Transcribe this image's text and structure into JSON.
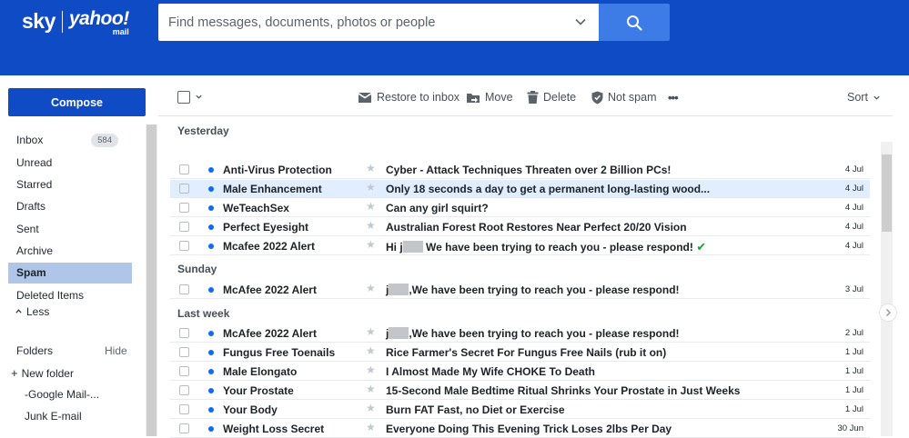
{
  "brand": {
    "sky": "sky",
    "yahoo": "yahoo!",
    "mail": "mail"
  },
  "search": {
    "placeholder": "Find messages, documents, photos or people"
  },
  "sidebar": {
    "compose": "Compose",
    "folders": [
      {
        "label": "Inbox",
        "badge": "584"
      },
      {
        "label": "Unread"
      },
      {
        "label": "Starred"
      },
      {
        "label": "Drafts"
      },
      {
        "label": "Sent"
      },
      {
        "label": "Archive"
      },
      {
        "label": "Spam",
        "active": true
      },
      {
        "label": "Deleted Items"
      }
    ],
    "less": "Less",
    "folders_header": "Folders",
    "hide": "Hide",
    "new_folder": "New folder",
    "custom_folders": [
      "-Google Mail-...",
      "Junk E-mail"
    ]
  },
  "toolbar": {
    "restore": "Restore to inbox",
    "move": "Move",
    "delete": "Delete",
    "not_spam": "Not spam",
    "more": "•••",
    "sort": "Sort"
  },
  "groups": [
    {
      "label": "Yesterday",
      "messages": [
        {
          "from": "Anti-Virus Protection",
          "subject": "Cyber - Attack Techniques Threaten over 2 Billion PCs!",
          "date": "4 Jul"
        },
        {
          "from": "Male Enhancement",
          "subject": "Only 18 seconds a day to get a permanent long-lasting wood...",
          "date": "4 Jul",
          "selected": true
        },
        {
          "from": "WeTeachSex",
          "subject": "Can any girl squirt?",
          "date": "4 Jul"
        },
        {
          "from": "Perfect Eyesight",
          "subject": "Australian Forest Root Restores Near Perfect 20/20 Vision",
          "date": "4 Jul"
        },
        {
          "from": "Mcafee 2022 Alert",
          "subject_pre": "Hi j",
          "subject": " We have been trying to reach you - please respond!",
          "check": "✔",
          "date": "4 Jul"
        }
      ]
    },
    {
      "label": "Sunday",
      "messages": [
        {
          "from": "McAfee 2022 Alert",
          "subject_pre": "j",
          "subject": ",We have been trying to reach you - please respond!",
          "date": "3 Jul"
        }
      ]
    },
    {
      "label": "Last week",
      "messages": [
        {
          "from": "McAfee 2022 Alert",
          "subject_pre": "j",
          "subject": ",We have been trying to reach you - please respond!",
          "date": "2 Jul"
        },
        {
          "from": "Fungus Free Toenails",
          "subject": "Rice Farmer's Secret For Fungus Free Nails (rub it on)",
          "date": "1 Jul"
        },
        {
          "from": "Male Elongato",
          "subject": "I Almost Made My Wife CHOKE To Death",
          "date": "1 Jul"
        },
        {
          "from": "Your Prostate",
          "subject": "15-Second Male Bedtime Ritual Shrinks Your Prostate in Just Weeks",
          "date": "1 Jul"
        },
        {
          "from": "Your Body",
          "subject": "Burn FAT Fast, no Diet or Exercise",
          "date": "1 Jul"
        },
        {
          "from": "Weight Loss Secret",
          "subject": "Everyone Doing This Evening Trick Loses 2lbs Per Day",
          "date": "30 Jun"
        }
      ]
    }
  ]
}
